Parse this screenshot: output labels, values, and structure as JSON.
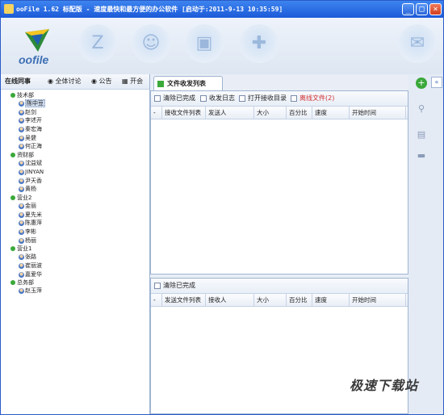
{
  "window": {
    "title": "ooFile 1.62 标配版 - 速度最快和最方便的办公软件 [启动于:2011-9-13 10:35:59]",
    "minimize": "_",
    "maximize": "□",
    "close": "×"
  },
  "toolbar": {
    "logo_text": "oofile",
    "icons": [
      "send-file-icon",
      "contacts-icon",
      "safe-icon",
      "settings-icon",
      "chat-icon"
    ]
  },
  "left_panel": {
    "online_label": "在线同事",
    "tabs": [
      "全体讨论",
      "公告",
      "开会"
    ]
  },
  "tree": [
    {
      "group": "技术部",
      "users": [
        "陈中豆",
        "赵剑",
        "李述开",
        "秦宏海",
        "吴健",
        "何正海"
      ]
    },
    {
      "group": "资财部",
      "users": [
        "沈益斌",
        "JINYAN",
        "尹天香",
        "黄杨"
      ]
    },
    {
      "group": "营业2",
      "users": [
        "金丽",
        "夏先米",
        "陈惠萍",
        "李彬",
        "杨丽"
      ]
    },
    {
      "group": "营业1",
      "users": [
        "张路",
        "崔丽波",
        "嘉爱华"
      ]
    },
    {
      "group": "总务部",
      "users": [
        "赵玉萍"
      ]
    }
  ],
  "selected_user": "陈中豆",
  "main": {
    "tab_label": "文件收发列表",
    "top_toolbar": [
      "清除已完成",
      "收发日志",
      "打开接收目录",
      "离线文件(2)"
    ],
    "top_columns": [
      "-",
      "接收文件列表",
      "发送人",
      "大小",
      "百分比",
      "速度",
      "开始时间"
    ],
    "bottom_toolbar": [
      "清除已完成"
    ],
    "bottom_columns": [
      "-",
      "发送文件列表",
      "接收人",
      "大小",
      "百分比",
      "速度",
      "开始时间"
    ]
  },
  "right_bar": {
    "collapse": "«",
    "icons": [
      "add-icon",
      "brush-icon",
      "note-icon",
      "card-icon"
    ]
  },
  "watermark": "极速下载站",
  "colors": {
    "titlebar": "#1c5ad8",
    "accent": "#3d6fb4",
    "offline": "#d03030"
  }
}
